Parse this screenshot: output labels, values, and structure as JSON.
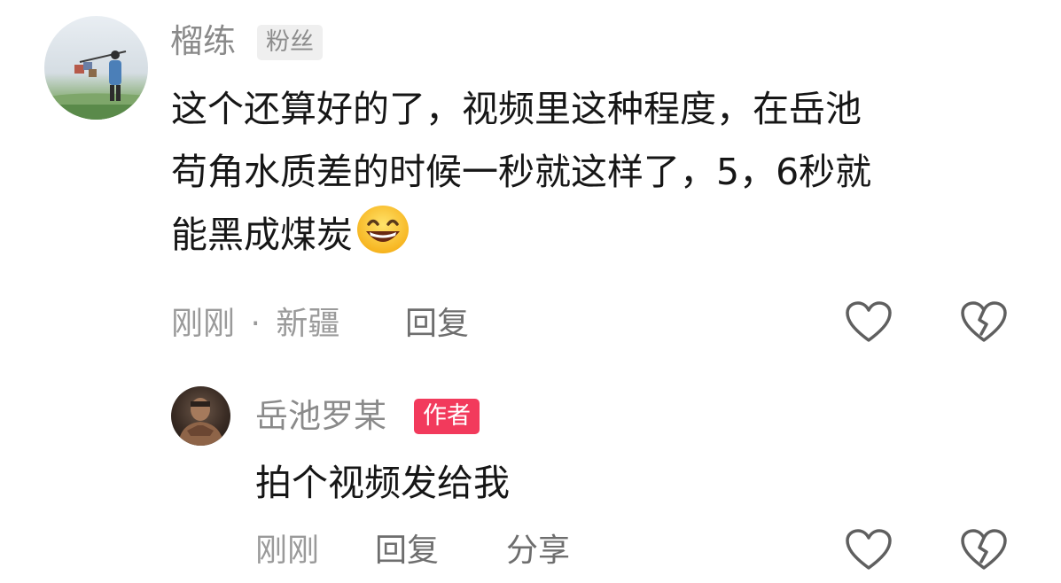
{
  "comment": {
    "username": "榴练",
    "badge": "粉丝",
    "text_lines": [
      "这个还算好的了，视频里这种程度，在岳池",
      "苟角水质差的时候一秒就这样了，5，6秒就",
      "能黑成煤炭"
    ],
    "emoji": "grinning-face-emoji",
    "time": "刚刚",
    "separator": "·",
    "location": "新疆",
    "reply_label": "回复",
    "like_icon": "heart-outline-icon",
    "dislike_icon": "broken-heart-icon"
  },
  "reply": {
    "username": "岳池罗某",
    "badge": "作者",
    "text": "拍个视频发给我",
    "time": "刚刚",
    "reply_label": "回复",
    "share_label": "分享",
    "like_icon": "heart-outline-icon",
    "dislike_icon": "broken-heart-icon"
  },
  "colors": {
    "username": "#8a8a8a",
    "author_badge": "#f23a5c",
    "fan_badge_bg": "#efefef",
    "body_text": "#161616",
    "meta_text": "#9a9a9a"
  }
}
